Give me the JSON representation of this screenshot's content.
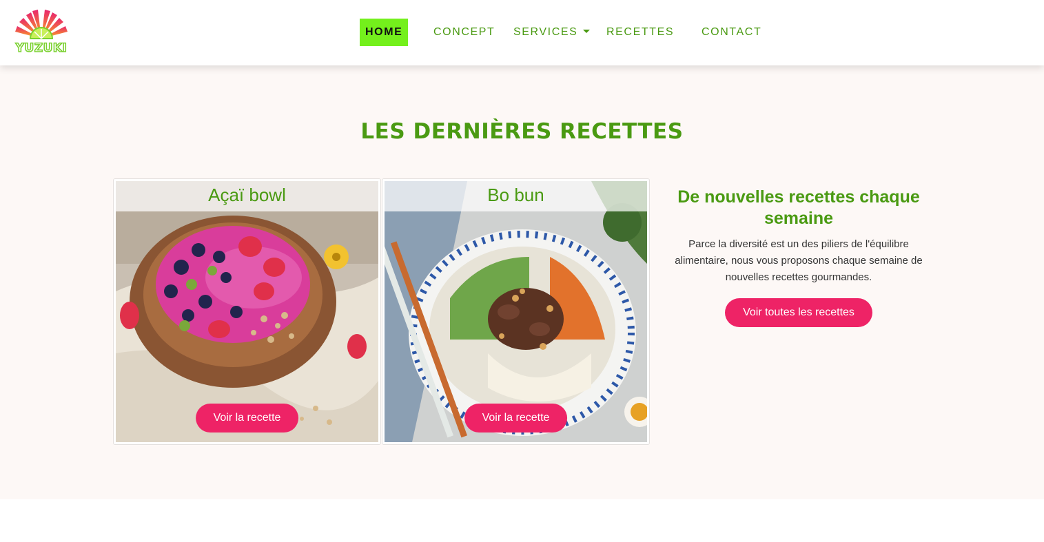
{
  "brand": {
    "logo_text": "YUZUKI",
    "colors": {
      "green": "#4a9a12",
      "lime": "#74f01c",
      "pink": "#ee2366",
      "section_bg": "#fdf8f6"
    }
  },
  "nav": {
    "items": [
      {
        "label": "HOME",
        "active": true
      },
      {
        "label": "CONCEPT"
      },
      {
        "label": "SERVICES",
        "icon": "caret-down-icon"
      },
      {
        "label": "RECETTES"
      },
      {
        "label": "CONTACT"
      }
    ]
  },
  "section": {
    "title": "LES DERNIÈRES RECETTES",
    "cards": [
      {
        "title": "Açaï bowl",
        "button": "Voir la recette",
        "image": "acai-bowl-photo"
      },
      {
        "title": "Bo bun",
        "button": "Voir la recette",
        "image": "bo-bun-photo"
      }
    ],
    "side": {
      "title": "De nouvelles recettes chaque semaine",
      "text": "Parce la diversité est un des piliers de l'équilibre alimentaire, nous vous proposons chaque semaine de nouvelles recettes gourmandes.",
      "button": "Voir toutes les recettes"
    }
  }
}
